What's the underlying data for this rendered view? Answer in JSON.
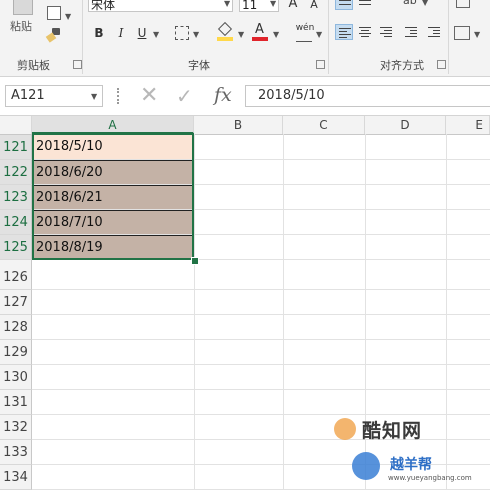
{
  "ribbon": {
    "clipboard": {
      "paste_label": "粘贴",
      "group_label": "剪贴板"
    },
    "font": {
      "font_name": "宋体",
      "font_size": "11",
      "bold": "B",
      "italic": "I",
      "underline": "U",
      "grow": "A",
      "shrink": "A",
      "color_letter": "A",
      "phonetic": "wén",
      "group_label": "字体"
    },
    "alignment": {
      "group_label": "对齐方式"
    },
    "colors": {
      "font_color": "#e0242b",
      "fill_color": "#ffd84a"
    }
  },
  "formula_bar": {
    "name_box": "A121",
    "fx": "fx",
    "value": "2018/5/10"
  },
  "grid": {
    "columns": [
      "A",
      "B",
      "C",
      "D",
      "E"
    ],
    "rows": [
      "121",
      "122",
      "123",
      "124",
      "125",
      "126",
      "127",
      "128",
      "129",
      "130",
      "131",
      "132",
      "133",
      "134"
    ],
    "cells_a": [
      "2018/5/10",
      "2018/6/20",
      "2018/6/21",
      "2018/7/10",
      "2018/8/19"
    ],
    "first_cell_fill": "#fbe4d5",
    "selected_fill": "#c4b2a6",
    "accent": "#217346"
  },
  "watermark": {
    "brand_cn": "酷知网",
    "brand_cn2": "越羊帮",
    "brand_url": "www.yueyangbang.com"
  }
}
